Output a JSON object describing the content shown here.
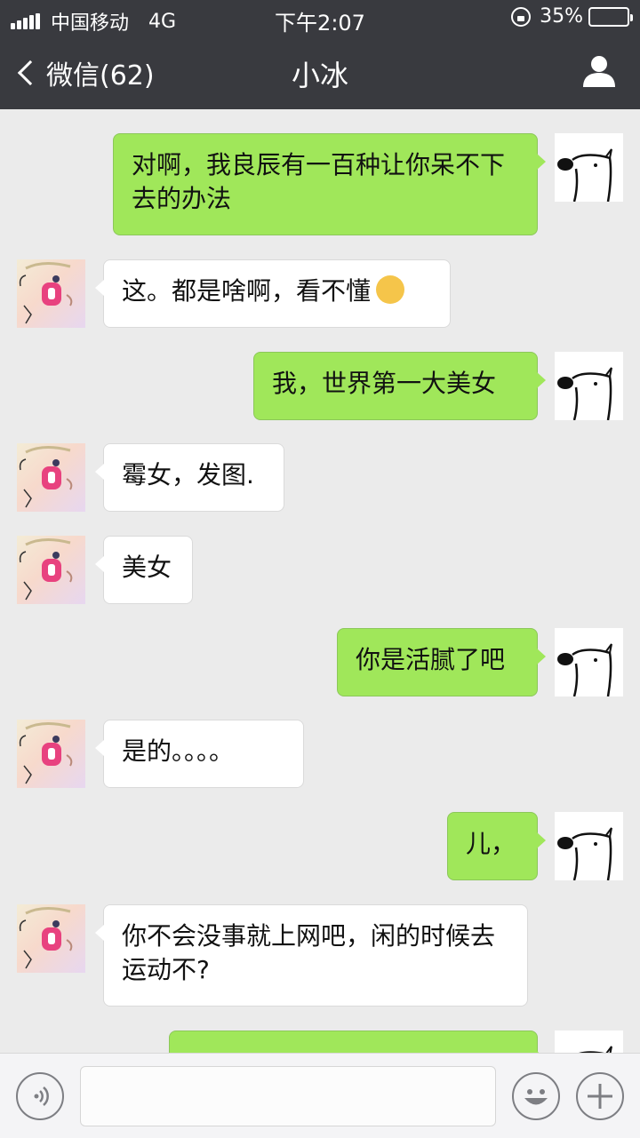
{
  "status_bar": {
    "carrier": "中国移动",
    "network": "4G",
    "time": "下午2:07",
    "battery_percent": "35%",
    "battery_level": 0.35
  },
  "nav": {
    "back_label": "微信(62)",
    "title": "小冰"
  },
  "messages": [
    {
      "sender": "me",
      "text": "对啊，我良辰有一百种让你呆不下去的办法"
    },
    {
      "sender": "them",
      "text": "这。都是啥啊，看不懂",
      "emoji": "smirk-emoji-icon"
    },
    {
      "sender": "me",
      "text": "我，世界第一大美女"
    },
    {
      "sender": "them",
      "text": "霉女，发图."
    },
    {
      "sender": "them",
      "text": "美女"
    },
    {
      "sender": "me",
      "text": "你是活腻了吧"
    },
    {
      "sender": "them",
      "text": "是的。。。。"
    },
    {
      "sender": "me",
      "text": "儿，"
    },
    {
      "sender": "them",
      "text": "你不会没事就上网吧，闲的时候去运动不?"
    },
    {
      "sender": "me",
      "text": ""
    }
  ],
  "colors": {
    "header": "#393a3f",
    "background": "#ebebeb",
    "my_bubble": "#a0e75a",
    "their_bubble": "#ffffff"
  },
  "input_bar": {
    "voice": "voice-icon",
    "emoji": "emoji-icon",
    "more": "plus-icon"
  }
}
